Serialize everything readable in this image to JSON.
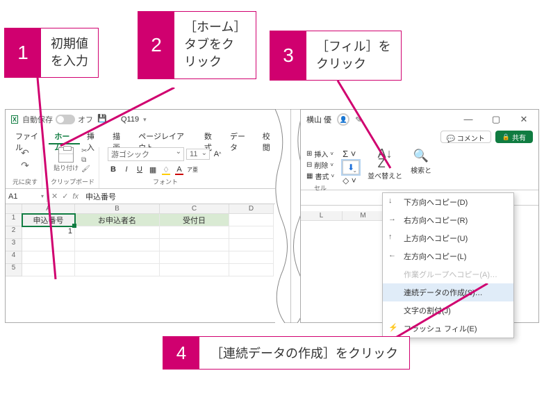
{
  "callouts": {
    "c1": {
      "num": "1",
      "text": "初期値\nを入力"
    },
    "c2": {
      "num": "2",
      "text": "［ホーム］\nタブをク\nリック"
    },
    "c3": {
      "num": "3",
      "text": "［フィル］を\nクリック"
    },
    "c4": {
      "num": "4",
      "text": "［連続データの作成］をクリック"
    }
  },
  "titlebar": {
    "autosave_label": "自動保存",
    "toggle_state": "オフ",
    "docname": "Q119"
  },
  "tabs": {
    "file": "ファイル",
    "home": "ホーム",
    "insert": "挿入",
    "draw": "描画",
    "layout": "ページレイアウト",
    "formulas": "数式",
    "data": "データ",
    "review": "校閲"
  },
  "ribbon": {
    "undo": "元に戻す",
    "paste": "貼り付け",
    "clipboard": "クリップボード",
    "fontname": "游ゴシック",
    "fontsize": "11",
    "fontgroup": "フォント"
  },
  "formula": {
    "name": "A1",
    "value": "申込番号"
  },
  "cols": {
    "A": "A",
    "B": "B",
    "C": "C",
    "D": "D",
    "L": "L",
    "M": "M"
  },
  "rows": {
    "r1": "1",
    "r2": "2",
    "r3": "3",
    "r4": "4",
    "r5": "5"
  },
  "headers": {
    "A": "申込番号",
    "B": "お申込者名",
    "C": "受付日"
  },
  "cells": {
    "A2": "1"
  },
  "titleR": {
    "user": "横山 優"
  },
  "actions": {
    "comment": "コメント",
    "share": "共有"
  },
  "cellsGroup": {
    "insert": "挿入",
    "delete": "削除",
    "format": "書式",
    "group": "セル"
  },
  "sort": "並べ替えと",
  "find": "検索と",
  "fillmenu": {
    "down": "下方向へコピー(D)",
    "right": "右方向へコピー(R)",
    "up": "上方向へコピー(U)",
    "left": "左方向へコピー(L)",
    "group": "作業グループへコピー(A)…",
    "series": "連続データの作成(S)…",
    "justify": "文字の割付(J)",
    "flash": "フラッシュ フィル(E)"
  }
}
